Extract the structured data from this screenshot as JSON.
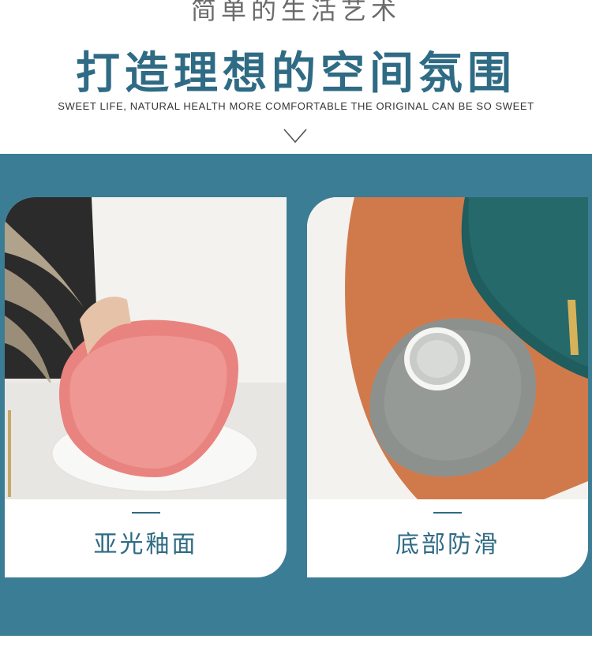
{
  "header": {
    "top_subtitle": "简单的生活艺术",
    "title": "打造理想的空间氛围",
    "english_line": "SWEET LIFE, NATURAL HEALTH MORE COMFORTABLE THE ORIGINAL CAN BE SO SWEET",
    "scroll_icon": "chevron-down-icon"
  },
  "cards": [
    {
      "caption": "亚光釉面",
      "image": "pink-matte-plate-photo"
    },
    {
      "caption": "底部防滑",
      "image": "gray-bowl-bottom-photo"
    }
  ],
  "colors": {
    "accent": "#2f6b84",
    "band": "#3c7d96",
    "text_gray": "#6b6b6b"
  }
}
